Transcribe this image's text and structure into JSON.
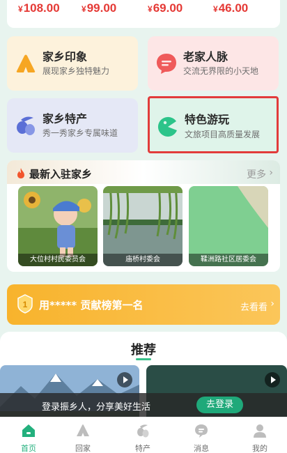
{
  "prices": [
    {
      "symbol": "¥",
      "amount": "108.00"
    },
    {
      "symbol": "¥",
      "amount": "99.00"
    },
    {
      "symbol": "¥",
      "amount": "69.00"
    },
    {
      "symbol": "¥",
      "amount": "46.00"
    }
  ],
  "features": [
    {
      "title": "家乡印象",
      "subtitle": "展现家乡独特魅力",
      "icon": "mountain-icon",
      "color": "#f6a623"
    },
    {
      "title": "老家人脉",
      "subtitle": "交流无界限的小天地",
      "icon": "chat-icon",
      "color": "#ef5a5a"
    },
    {
      "title": "家乡特产",
      "subtitle": "秀一秀家乡专属味道",
      "icon": "olive-icon",
      "color": "#5b6fd6"
    },
    {
      "title": "特色游玩",
      "subtitle": "文旅项目高质量发展",
      "icon": "pacman-icon",
      "color": "#2cc48a"
    }
  ],
  "newest": {
    "title": "最新入驻家乡",
    "more_label": "更多",
    "items": [
      {
        "caption": "大位村村民委员会"
      },
      {
        "caption": "庙桥村委会"
      },
      {
        "caption": "鞣洲路社区居委会"
      }
    ]
  },
  "ranking": {
    "text": "用***** 贡献榜第一名",
    "link": "去看看",
    "badge": "1"
  },
  "recommend": {
    "title": "推荐"
  },
  "login": {
    "text": "登录振乡人，分享美好生活",
    "button": "去登录"
  },
  "tabs": [
    {
      "label": "首页",
      "icon": "home-icon",
      "active": true
    },
    {
      "label": "回家",
      "icon": "mountain-icon",
      "active": false
    },
    {
      "label": "特产",
      "icon": "olive-icon",
      "active": false
    },
    {
      "label": "消息",
      "icon": "chat-icon",
      "active": false
    },
    {
      "label": "我的",
      "icon": "user-icon",
      "active": false
    }
  ],
  "colors": {
    "accent": "#23b07d",
    "price": "#e53935",
    "highlight_border": "#e23b3b"
  }
}
